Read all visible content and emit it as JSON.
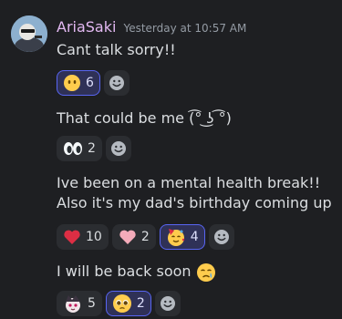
{
  "message": {
    "author": "AriaSaki",
    "timestamp": "Yesterday at 10:57 AM",
    "lines": [
      {
        "text": "Cant talk sorry!!",
        "reactions": [
          {
            "emoji": "no-mouth-face",
            "count": "6",
            "mine": true
          }
        ]
      },
      {
        "text": "That could be me (͡° ͜ʖ ͡°)",
        "reactions": [
          {
            "emoji": "eyes",
            "count": "2",
            "mine": false
          }
        ]
      },
      {
        "text": "Ive been on a mental health break!! Also it's my dad's birthday coming up",
        "reactions": [
          {
            "emoji": "red-heart",
            "count": "10",
            "mine": false
          },
          {
            "emoji": "pink-heart",
            "count": "2",
            "mine": false
          },
          {
            "emoji": "partying-face",
            "count": "4",
            "mine": true
          }
        ]
      },
      {
        "text": "I will be back soon",
        "reactions": [
          {
            "emoji": "anime-sticker",
            "count": "5",
            "mine": false
          },
          {
            "emoji": "pleading-face",
            "count": "2",
            "mine": true
          }
        ]
      }
    ]
  }
}
